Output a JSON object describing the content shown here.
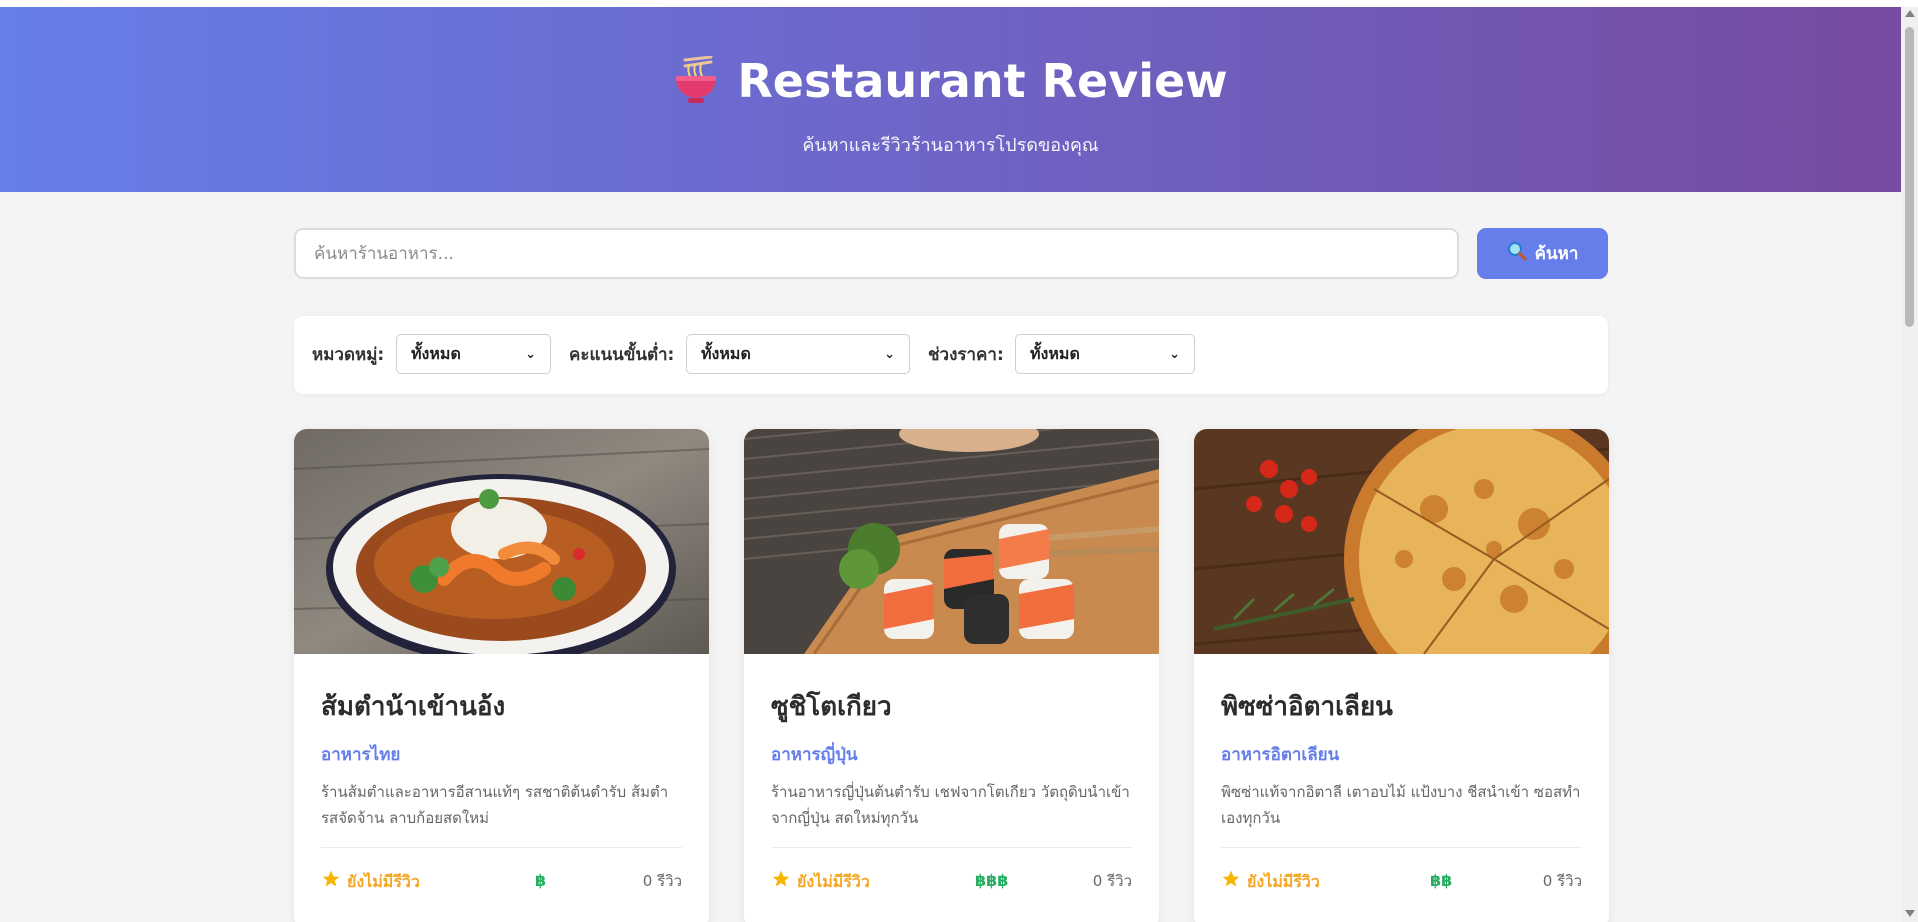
{
  "header": {
    "title": "Restaurant Review",
    "icon": "noodle-bowl-icon",
    "subtitle": "ค้นหาและรีวิวร้านอาหารโปรดของคุณ"
  },
  "search": {
    "placeholder": "ค้นหาร้านอาหาร...",
    "value": "",
    "button_label": "ค้นหา",
    "button_icon": "magnifier-icon"
  },
  "filters": {
    "category": {
      "label": "หมวดหมู่:",
      "selected": "ทั้งหมด"
    },
    "min_rating": {
      "label": "คะแนนขั้นต่ำ:",
      "selected": "ทั้งหมด"
    },
    "price_range": {
      "label": "ช่วงราคา:",
      "selected": "ทั้งหมด"
    }
  },
  "restaurants": [
    {
      "name": "ส้มตำน้าเข้านอ้ง",
      "category": "อาหารไทย",
      "description": "ร้านส้มตำและอาหารอีสานแท้ๆ รสชาติต้นตำรับ ส้มตำรสจัดจ้าน ลาบก้อยสดใหม่",
      "rating_text": "ยังไม่มีรีวิว",
      "price": "฿",
      "reviews": "0 รีวิว",
      "image": "thai-curry-photo"
    },
    {
      "name": "ซูชิโตเกียว",
      "category": "อาหารญี่ปุ่น",
      "description": "ร้านอาหารญี่ปุ่นต้นตำรับ เชฟจากโตเกียว วัตถุดิบนำเข้าจากญี่ปุ่น สดใหม่ทุกวัน",
      "rating_text": "ยังไม่มีรีวิว",
      "price": "฿฿฿",
      "reviews": "0 รีวิว",
      "image": "sushi-photo"
    },
    {
      "name": "พิซซ่าอิตาเลียน",
      "category": "อาหารอิตาเลียน",
      "description": "พิซซ่าแท้จากอิตาลี เตาอบไม้ แป้งบาง ชีสนำเข้า ซอสทำเองทุกวัน",
      "rating_text": "ยังไม่มีรีวิว",
      "price": "฿฿",
      "reviews": "0 รีวิว",
      "image": "pizza-photo"
    }
  ],
  "colors": {
    "header_gradient_start": "#667eea",
    "header_gradient_end": "#764ba2",
    "accent": "#667eea",
    "rating": "#f5a623",
    "price": "#27ae60"
  }
}
